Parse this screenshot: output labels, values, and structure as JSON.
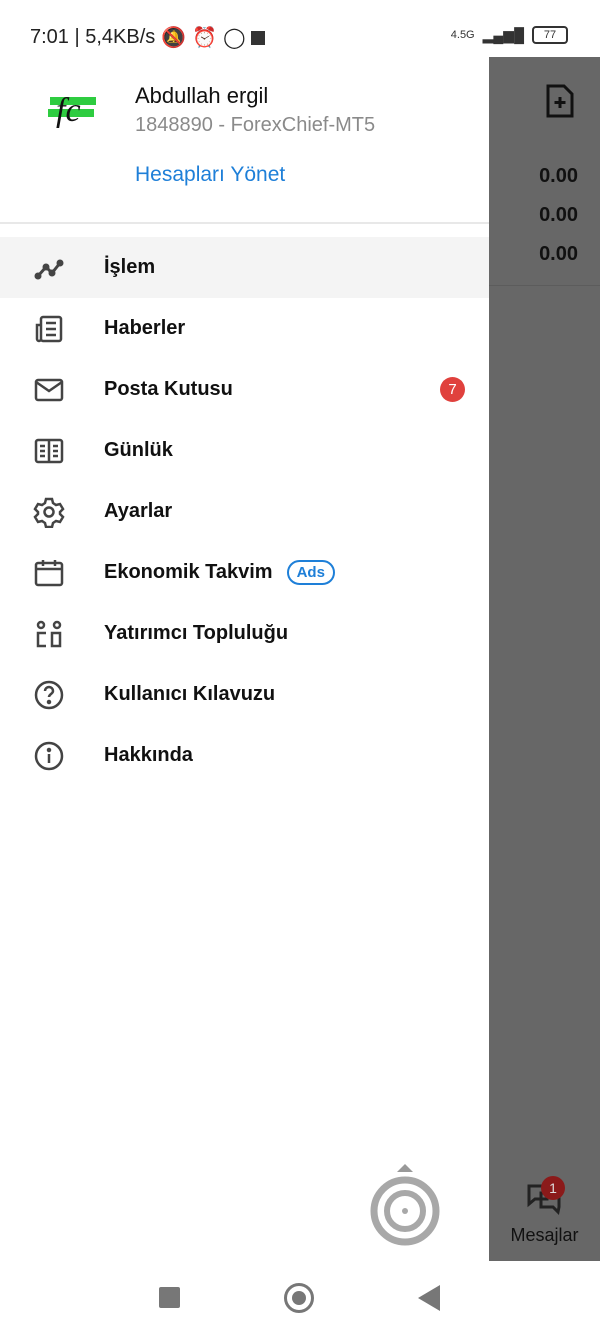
{
  "status_bar": {
    "time_speed": "7:01 | 5,4KB/s",
    "network": "4.5G",
    "battery": "77"
  },
  "account": {
    "name": "Abdullah ergil",
    "details": "1848890 - ForexChief-MT5",
    "manage_label": "Hesapları Yönet",
    "logo_text": "fc"
  },
  "menu": [
    {
      "label": "İşlem",
      "icon": "chart-line-icon"
    },
    {
      "label": "Haberler",
      "icon": "news-icon"
    },
    {
      "label": "Posta Kutusu",
      "icon": "mail-icon",
      "badge": "7"
    },
    {
      "label": "Günlük",
      "icon": "journal-icon"
    },
    {
      "label": "Ayarlar",
      "icon": "gear-icon"
    },
    {
      "label": "Ekonomik Takvim",
      "icon": "calendar-icon",
      "tag": "Ads"
    },
    {
      "label": "Yatırımcı Topluluğu",
      "icon": "community-icon"
    },
    {
      "label": "Kullanıcı Kılavuzu",
      "icon": "help-icon"
    },
    {
      "label": "Hakkında",
      "icon": "info-icon"
    }
  ],
  "background": {
    "values": [
      "0.00",
      "0.00",
      "0.00"
    ],
    "messages_label": "Mesajlar",
    "messages_badge": "1"
  }
}
